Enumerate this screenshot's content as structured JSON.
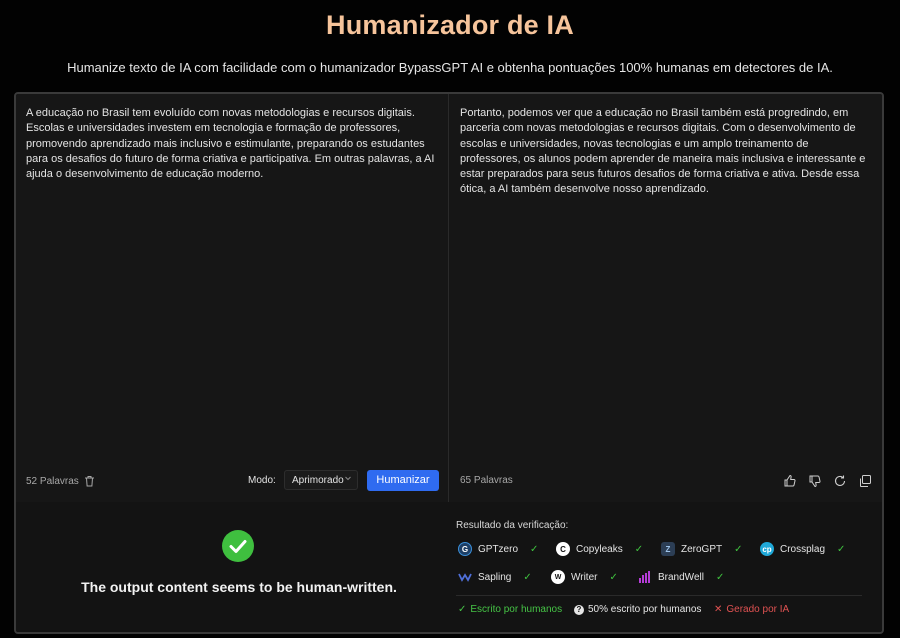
{
  "header": {
    "title": "Humanizador de IA",
    "subtitle": "Humanize texto de IA com facilidade com o humanizador BypassGPT AI e obtenha pontuações 100% humanas em detectores de IA."
  },
  "input_pane": {
    "text": "A educação no Brasil tem evoluído com novas metodologias e recursos digitais. Escolas e universidades investem em tecnologia e formação de professores, promovendo aprendizado mais inclusivo e estimulante, preparando os estudantes para os desafios do futuro de forma criativa e participativa. Em outras palavras, a AI ajuda o desenvolvimento de educação moderno.",
    "word_count": "52 Palavras",
    "mode_label": "Modo:",
    "mode_value": "Aprimorado",
    "humanize_label": "Humanizar"
  },
  "output_pane": {
    "text": "Portanto, podemos ver que a educação no Brasil também está progredindo, em parceria com novas metodologias e recursos digitais. Com o desenvolvimento de escolas e universidades, novas tecnologias e um amplo treinamento de professores, os alunos podem aprender de maneira mais inclusiva e interessante e estar preparados para seus futuros desafios de forma criativa e ativa. Desde essa ótica, a AI também desenvolve nosso aprendizado.",
    "word_count": "65 Palavras"
  },
  "result": {
    "message": "The output content seems to be human-written.",
    "verify_title": "Resultado da verificação:",
    "detectors": [
      {
        "name": "GPTzero",
        "icon": "gptzero-icon",
        "color": "#3b8fd9"
      },
      {
        "name": "Copyleaks",
        "icon": "copyleaks-icon",
        "color": "#ffffff"
      },
      {
        "name": "ZeroGPT",
        "icon": "zerogpt-icon",
        "color": "#5a7fa8"
      },
      {
        "name": "Crossplag",
        "icon": "crossplag-icon",
        "color": "#1fa8d8"
      },
      {
        "name": "Sapling",
        "icon": "sapling-icon",
        "color": "#4f6fd8"
      },
      {
        "name": "Writer",
        "icon": "writer-icon",
        "color": "#ffffff"
      },
      {
        "name": "BrandWell",
        "icon": "brandwell-icon",
        "color": "#b53cd8"
      }
    ],
    "legend": {
      "human": "Escrito por humanos",
      "half": "50% escrito por humanos",
      "ai": "Gerado por IA"
    }
  },
  "colors": {
    "title": "#f6c49b",
    "accent_button": "#2f6bf0",
    "success": "#3fbf3f",
    "danger": "#e05252"
  }
}
